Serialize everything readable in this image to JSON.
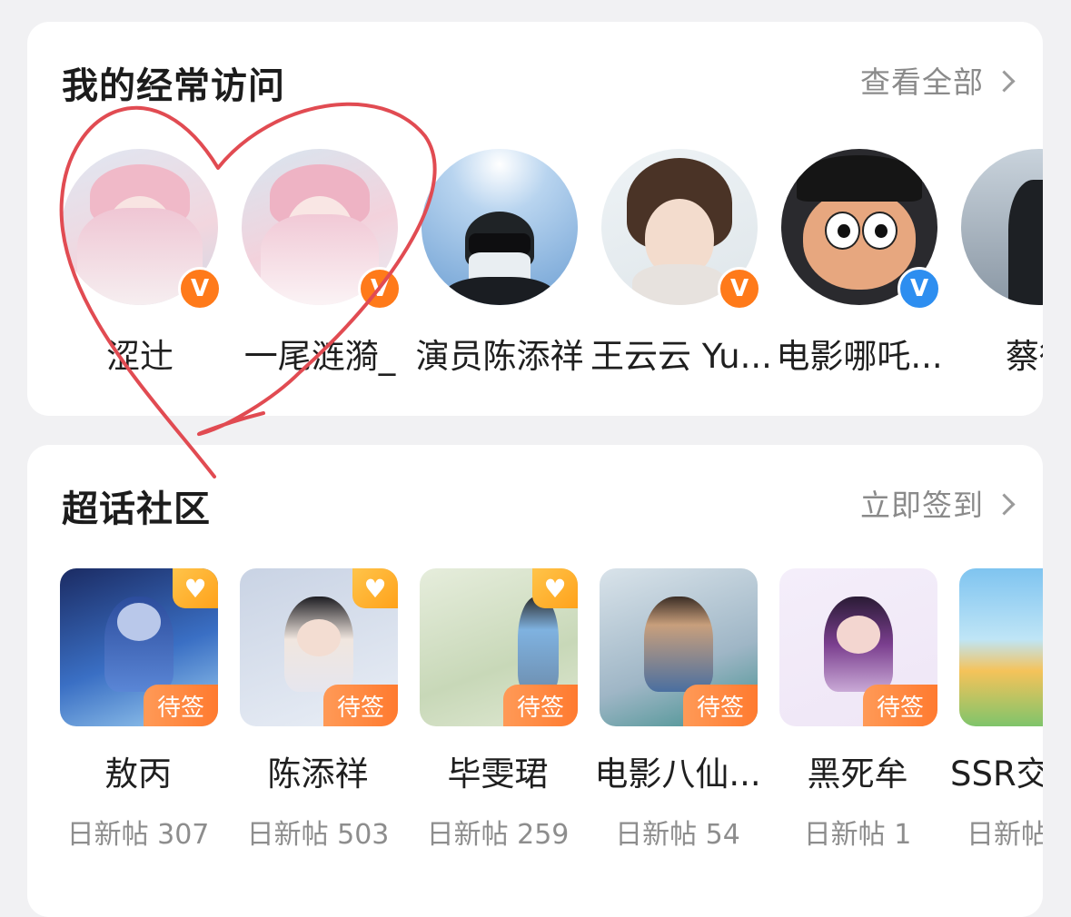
{
  "frequent": {
    "title": "我的经常访问",
    "view_all": "查看全部",
    "items": [
      {
        "name": "涩辻",
        "badge": "V",
        "badge_color": "#ff7a1a",
        "icon": "avatar-anime-girl"
      },
      {
        "name": "一尾涟漪_",
        "badge": "V",
        "badge_color": "#ff7a1a",
        "icon": "avatar-anime-angel"
      },
      {
        "name": "演员陈添祥",
        "badge": "",
        "badge_color": "",
        "icon": "avatar-masked-man"
      },
      {
        "name": "王云云 Yu...",
        "badge": "V",
        "badge_color": "#ff7a1a",
        "icon": "avatar-girl-photo"
      },
      {
        "name": "电影哪吒...",
        "badge": "V",
        "badge_color": "#2d8ef0",
        "icon": "avatar-nezha-cartoon"
      },
      {
        "name": "蔡徐",
        "badge": "",
        "badge_color": "",
        "icon": "avatar-person-dark"
      }
    ]
  },
  "supertopic": {
    "title": "超话社区",
    "checkin": "立即签到",
    "items": [
      {
        "name": "敖丙",
        "stat": "日新帖 307",
        "tag": "待签",
        "icon": "cover-aobing"
      },
      {
        "name": "陈添祥",
        "stat": "日新帖 503",
        "tag": "待签",
        "icon": "cover-chen"
      },
      {
        "name": "毕雯珺",
        "stat": "日新帖 259",
        "tag": "待签",
        "icon": "cover-bi"
      },
      {
        "name": "电影八仙...",
        "stat": "日新帖 54",
        "tag": "待签",
        "icon": "cover-baxian"
      },
      {
        "name": "黑死牟",
        "stat": "日新帖 1",
        "tag": "待签",
        "icon": "cover-heisimou"
      },
      {
        "name": "SSR交",
        "stat": "日新帖",
        "tag": "",
        "icon": "cover-ssr"
      }
    ]
  },
  "colors": {
    "accent_orange": "#ff7a2f",
    "link_gray": "#8a8a8a",
    "heart_doodle": "#e14b52"
  }
}
